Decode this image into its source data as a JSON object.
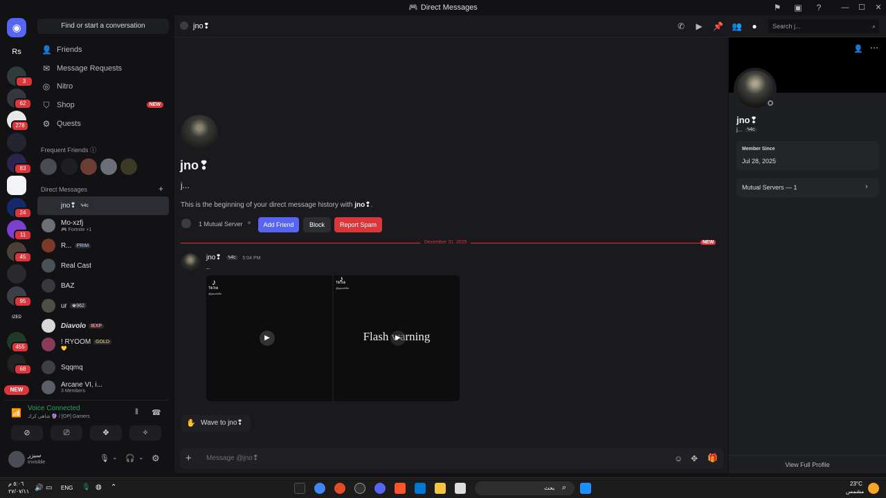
{
  "window": {
    "title": "Direct Messages"
  },
  "sidebar": {
    "search_placeholder": "Find or start a conversation",
    "nav": [
      {
        "label": "Friends",
        "icon": "friends-icon"
      },
      {
        "label": "Message Requests",
        "icon": "mail-icon"
      },
      {
        "label": "Nitro",
        "icon": "nitro-icon"
      },
      {
        "label": "Shop",
        "icon": "shop-icon",
        "badge": "NEW"
      },
      {
        "label": "Quests",
        "icon": "quests-icon"
      }
    ],
    "frequent_friends_label": "Frequent Friends",
    "direct_messages_label": "Direct Messages",
    "dms": [
      {
        "name": "jno❢",
        "tag": "ϟ4c",
        "sub": ""
      },
      {
        "name": "Mo-xzfj",
        "tag": "",
        "sub": "🎮 Fortnite +1"
      },
      {
        "name": "R...",
        "tag": "PRIM",
        "sub": ""
      },
      {
        "name": "Real Cast",
        "tag": "",
        "sub": ""
      },
      {
        "name": "BAZ",
        "tag": "",
        "sub": ""
      },
      {
        "name": "ur",
        "tag": "♚962",
        "sub": ""
      },
      {
        "name": "Diavolo",
        "tag": "IEXP",
        "sub": ""
      },
      {
        "name": "! RYOOM",
        "tag": "GOLD",
        "sub": "💛"
      },
      {
        "name": "Sqqmq",
        "tag": "",
        "sub": ""
      },
      {
        "name": "Arcane VI, i...",
        "tag": "",
        "sub": "3 Members"
      }
    ]
  },
  "servers": {
    "badges": [
      "3",
      "62",
      "278",
      "83",
      "24",
      "11",
      "45",
      "95",
      "455",
      "68"
    ],
    "rs_label": "Rs",
    "ized_label": "IZED",
    "new_label": "NEW"
  },
  "voice": {
    "status": "Voice Connected",
    "channel": "شاهي كرك 🔮 / [OP] Gamers"
  },
  "user": {
    "name": "سيزر",
    "status": "Invisible"
  },
  "header": {
    "recipient": "jno❢",
    "search_placeholder": "Search j..."
  },
  "intro": {
    "display_name": "jno❢",
    "username": "j...",
    "beginning_text_prefix": "This is the beginning of your direct message history with ",
    "beginning_text_name": "jno❢",
    "beginning_text_suffix": ".",
    "mutual": "1 Mutual Server",
    "add_friend": "Add Friend",
    "block": "Block",
    "report_spam": "Report Spam"
  },
  "divider": {
    "date": "December 31, 2025",
    "new": "NEW"
  },
  "message": {
    "author": "jno❢",
    "tag": "ϟ4c",
    "time": "5:04 PM",
    "text": "..",
    "video1": {
      "brand": "TikTok",
      "handle": "@jana9l5e"
    },
    "video2": {
      "brand": "TikTok",
      "handle": "@jana9l5e",
      "overlay": "Flash warning"
    }
  },
  "wave_label": "Wave to jno❢",
  "composer": {
    "placeholder": "Message @jno❢"
  },
  "profile": {
    "display_name": "jno❢",
    "username": "j...",
    "tag": "ϟ4c",
    "member_since_label": "Member Since",
    "member_since": "Jul 28, 2025",
    "mutual_servers": "Mutual Servers — 1",
    "view_full": "View Full Profile"
  },
  "taskbar": {
    "time": "٥:٠٦ م",
    "date": "٢٧/٠٧/١١",
    "lang": "ENG",
    "search_placeholder": "بحث",
    "weather_temp": "23°C",
    "weather_label": "مشمس"
  },
  "colors": {
    "accent": "#5865f2",
    "danger": "#da373c",
    "voice_green": "#23a55a"
  }
}
